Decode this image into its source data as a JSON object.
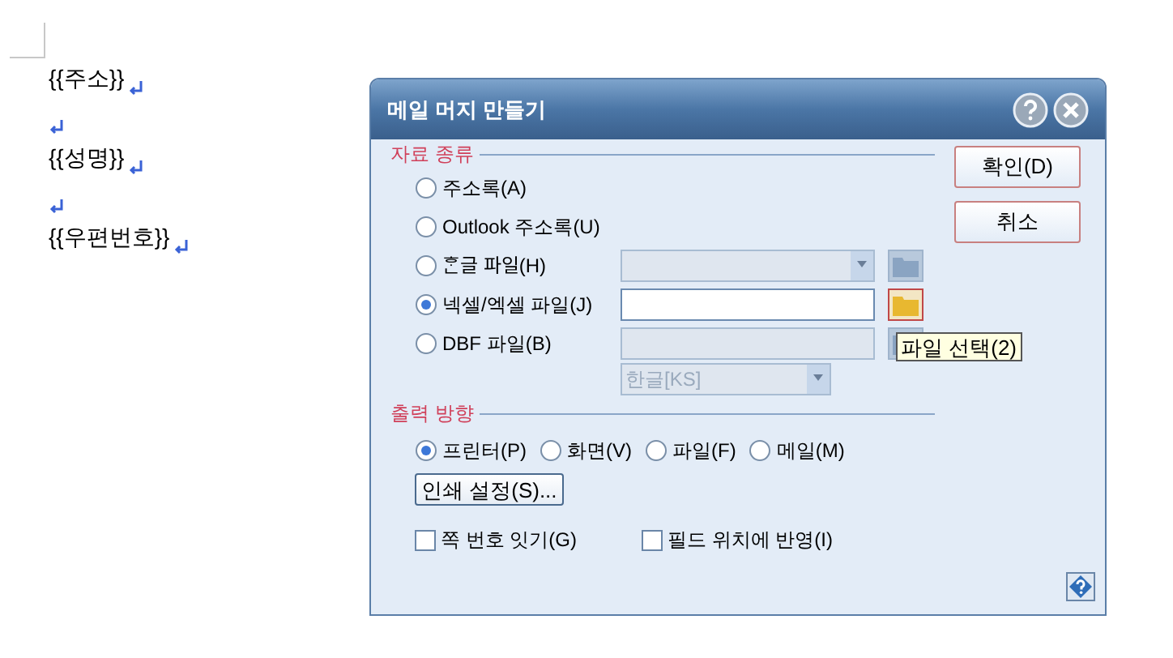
{
  "document": {
    "lines": [
      {
        "kind": "text",
        "text": "{{주소}}"
      },
      {
        "kind": "blank"
      },
      {
        "kind": "text",
        "text": "{{성명}}"
      },
      {
        "kind": "blank"
      },
      {
        "kind": "text",
        "text": "{{우편번호}}"
      }
    ]
  },
  "dialog": {
    "title": "메일 머지 만들기",
    "data_source": {
      "legend": "자료 종류",
      "options": [
        {
          "label": "주소록(A)",
          "selected": false
        },
        {
          "label": "Outlook 주소록(U)",
          "selected": false
        },
        {
          "label": "ᄒᆞᆫ글 파일(H)",
          "selected": false,
          "field": {
            "kind": "combo",
            "disabled": true
          }
        },
        {
          "label": "넥셀/엑셀 파일(J)",
          "selected": true,
          "field": {
            "kind": "text",
            "disabled": false
          }
        },
        {
          "label": "DBF 파일(B)",
          "selected": false,
          "field": {
            "kind": "text",
            "disabled": true
          },
          "encoding": {
            "value": "한글[KS]",
            "disabled": true
          }
        }
      ]
    },
    "tooltip": "파일 선택(2)",
    "output": {
      "legend": "출력 방향",
      "options": [
        {
          "label": "프린터(P)",
          "selected": true
        },
        {
          "label": "화면(V)",
          "selected": false
        },
        {
          "label": "파일(F)",
          "selected": false
        },
        {
          "label": "메일(M)",
          "selected": false
        }
      ],
      "setup_button": "인쇄 설정(S)..."
    },
    "checkboxes": [
      {
        "label": "쪽 번호 잇기(G)",
        "checked": false
      },
      {
        "label": "필드 위치에 반영(I)",
        "checked": false
      }
    ],
    "buttons": [
      "확인(D)",
      "취소"
    ]
  }
}
